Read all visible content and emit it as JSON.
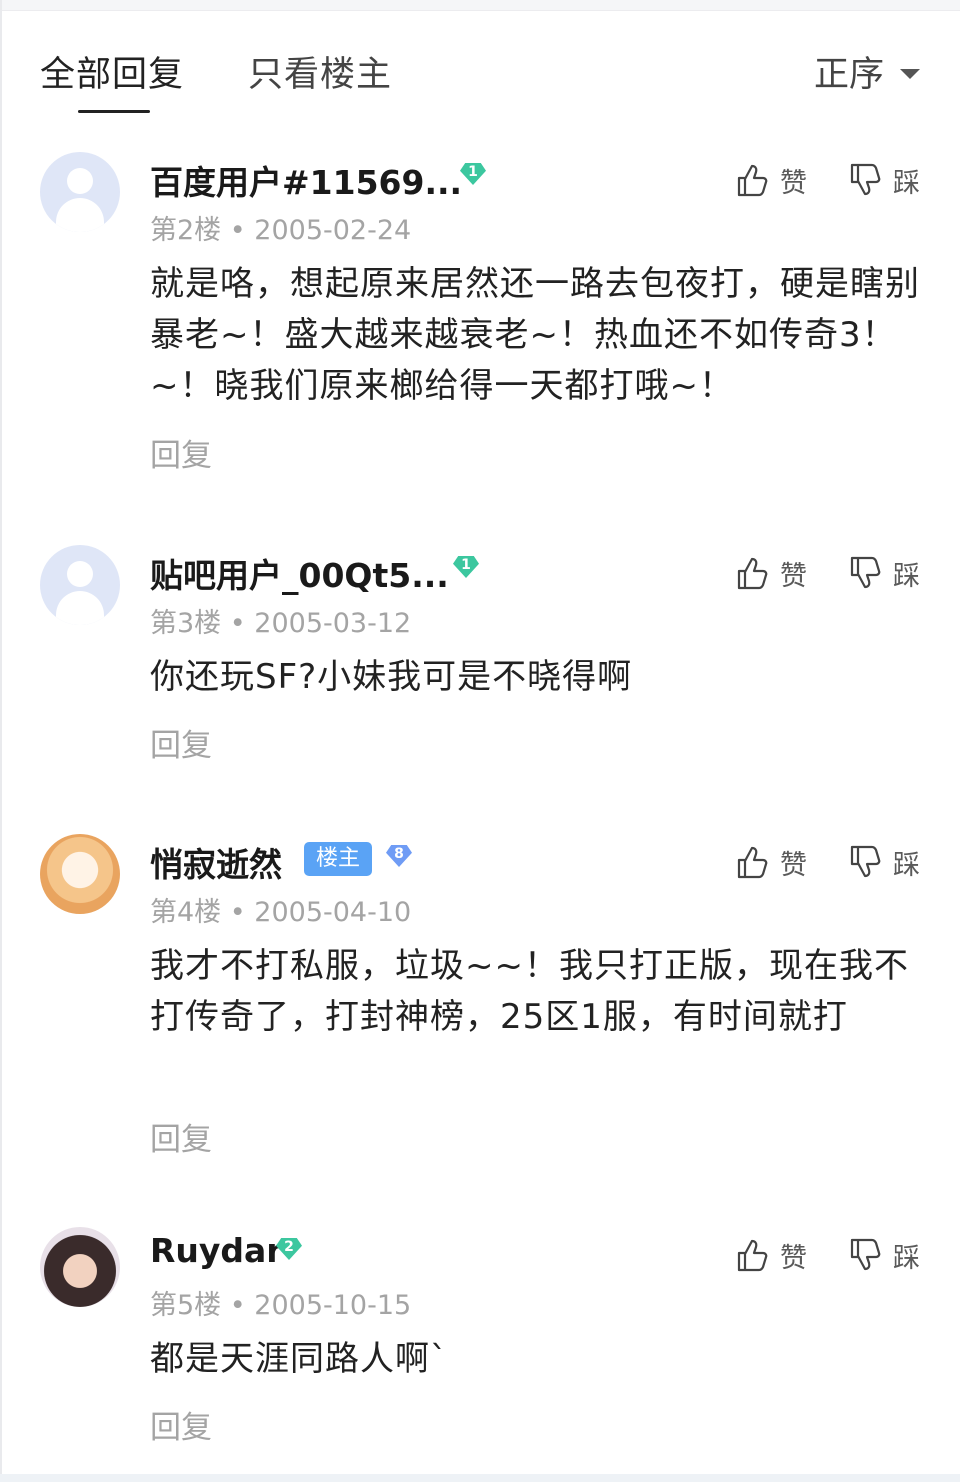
{
  "tabs": {
    "all_replies": "全部回复",
    "only_op": "只看楼主",
    "sort_label": "正序"
  },
  "actions": {
    "like": "赞",
    "dislike": "踩",
    "reply": "回复"
  },
  "colors": {
    "level_badge_green": "#3cc79f",
    "level_badge_blue": "#6f9cf5",
    "op_badge": "#5aa3f5",
    "meta_gray": "#a4a4a4"
  },
  "comments": [
    {
      "username": "百度用户#11569...",
      "level": "1",
      "floor": "第2楼",
      "date": "2005-02-24",
      "text": "就是咯，想起原来居然还一路去包夜打，硬是瞎别暴老~！盛大越来越衰老~！热血还不如传奇3！~！晓我们原来榔给得一天都打哦~！",
      "avatar": "default-avatar"
    },
    {
      "username": "贴吧用户_00Qt5...",
      "level": "1",
      "floor": "第3楼",
      "date": "2005-03-12",
      "text": "你还玩SF?小妹我可是不晓得啊",
      "avatar": "default-avatar"
    },
    {
      "username": "悄寂逝然",
      "op_badge": "楼主",
      "level": "8",
      "floor": "第4楼",
      "date": "2005-04-10",
      "text": "我才不打私服，垃圾~~！我只打正版，现在我不打传奇了，打封神榜，25区1服，有时间就打",
      "avatar": "anime-avatar"
    },
    {
      "username": "Ruydar",
      "level": "2",
      "floor": "第5楼",
      "date": "2005-10-15",
      "text": "都是天涯同路人啊`",
      "avatar": "photo-avatar"
    }
  ]
}
